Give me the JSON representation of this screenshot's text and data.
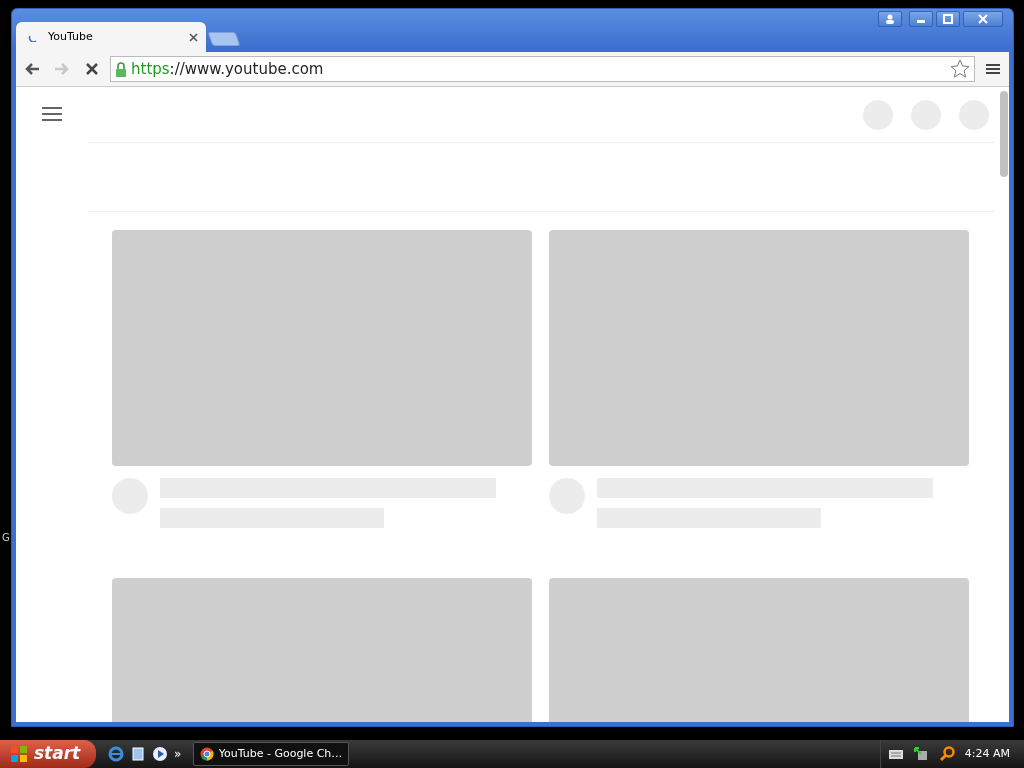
{
  "desktop": {
    "edge_text": "G"
  },
  "browser": {
    "tabs": [
      {
        "title": "YouTube",
        "selected": true,
        "loading": true
      }
    ],
    "address": {
      "scheme": "https",
      "rest": "://www.youtube.com",
      "secure": true
    },
    "loading": true,
    "forward_enabled": false
  },
  "taskbar": {
    "start": "start",
    "more": "»",
    "windows": [
      {
        "title": "YouTube - Google Ch…",
        "selected": true
      }
    ],
    "clock": "4:24 AM"
  }
}
